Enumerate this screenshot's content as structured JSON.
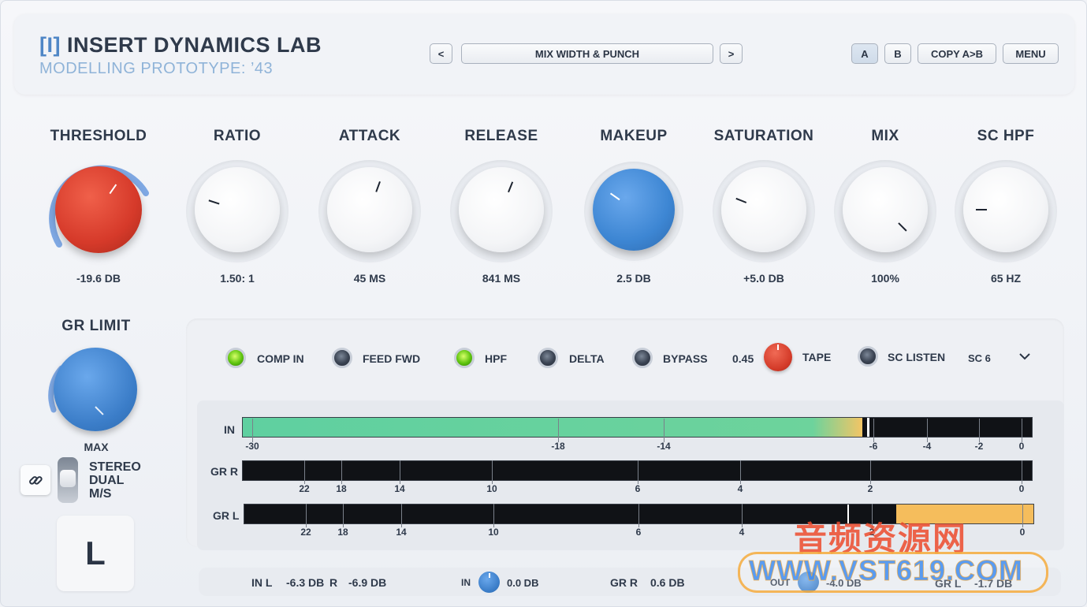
{
  "header": {
    "logo_mark": "[I]",
    "title": "INSERT DYNAMICS LAB",
    "subtitle": "MODELLING PROTOTYPE: ’43",
    "prev_label": "<",
    "preset_name": "MIX WIDTH & PUNCH",
    "next_label": ">",
    "a_label": "A",
    "b_label": "B",
    "copy_label": "COPY A>B",
    "menu_label": "MENU"
  },
  "knobs": [
    {
      "label": "THRESHOLD",
      "value": "-19.6 DB",
      "color": "#d63a2a"
    },
    {
      "label": "RATIO",
      "value": "1.50: 1",
      "color": "#ffffff"
    },
    {
      "label": "ATTACK",
      "value": "45 MS",
      "color": "#ffffff"
    },
    {
      "label": "RELEASE",
      "value": "841 MS",
      "color": "#ffffff"
    },
    {
      "label": "MAKEUP",
      "value": "2.5 DB",
      "color": "#3d86d3"
    },
    {
      "label": "SATURATION",
      "value": "+5.0 DB",
      "color": "#ffffff"
    },
    {
      "label": "MIX",
      "value": "100%",
      "color": "#ffffff"
    },
    {
      "label": "SC HPF",
      "value": "65 HZ",
      "color": "#ffffff"
    }
  ],
  "gr_limit": {
    "label": "GR LIMIT",
    "value": "MAX"
  },
  "stereo_mode": {
    "options": [
      "STEREO",
      "DUAL",
      "M/S"
    ],
    "channel": "L"
  },
  "toggles": {
    "comp_in": "COMP IN",
    "feed_fwd": "FEED FWD",
    "hpf": "HPF",
    "delta": "DELTA",
    "bypass": "BYPASS",
    "tape_value": "0.45",
    "tape": "TAPE",
    "sc_listen": "SC LISTEN",
    "sc_select": "SC 6"
  },
  "meters": {
    "in_label": "IN",
    "grr_label": "GR R",
    "grl_label": "GR L",
    "in_ticks": [
      "-30",
      "-18",
      "-14",
      "-6",
      "-4",
      "-2",
      "0"
    ],
    "gr_ticks": [
      "22",
      "18",
      "14",
      "10",
      "6",
      "4",
      "2",
      "0"
    ]
  },
  "footer": {
    "in_l_label": "IN L",
    "in_l_value": "-6.3 DB",
    "in_r_label": "R",
    "in_r_value": "-6.9 DB",
    "in_gain_label": "IN",
    "in_gain_value": "0.0 DB",
    "gr_r_label": "GR R",
    "gr_r_value": "0.6 DB",
    "out_label": "OUT",
    "out_value": "-4.0 DB",
    "gr_l_label": "GR L",
    "gr_l_value": "-1.7 DB"
  },
  "watermark": {
    "line1": "音频资源网",
    "line2": "WWW.VST619.COM"
  }
}
